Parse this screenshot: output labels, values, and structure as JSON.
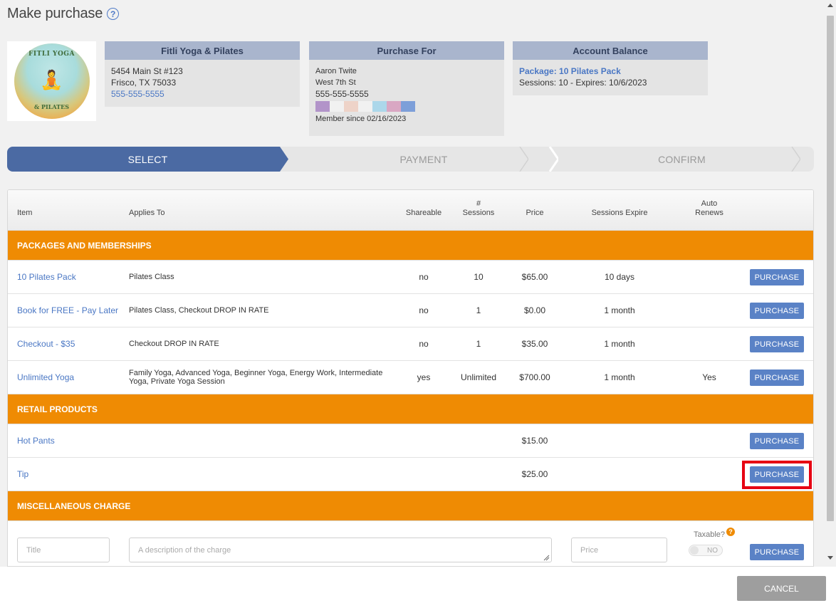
{
  "header": {
    "title": "Make purchase",
    "help_icon": "help-circle-icon"
  },
  "studio": {
    "logo_text_top": "FITLI YOGA",
    "logo_text_bottom": "& PILATES",
    "name": "Fitli Yoga & Pilates",
    "address1": "5454 Main St #123",
    "address2": "Frisco, TX 75033",
    "phone": "555-555-5555"
  },
  "purchase_for": {
    "heading": "Purchase For",
    "name": "Aaron Twite",
    "street": "West 7th St",
    "phone": "555-555-5555",
    "swatch_colors": [
      "#b294c9",
      "#f1f1f1",
      "#eed3c8",
      "#f1f1f1",
      "#acd7ea",
      "#d9a7c3",
      "#7d9fd9"
    ],
    "member_since": "Member since 02/16/2023"
  },
  "account_balance": {
    "heading": "Account Balance",
    "package": "Package: 10 Pilates Pack",
    "sessions": "Sessions: 10 -  Expires: 10/6/2023"
  },
  "steps": [
    "SELECT",
    "PAYMENT",
    "CONFIRM"
  ],
  "columns": {
    "item": "Item",
    "applies_to": "Applies To",
    "shareable": "Shareable",
    "sessions_line1": "#",
    "sessions_line2": "Sessions",
    "price": "Price",
    "expire": "Sessions Expire",
    "auto_line1": "Auto",
    "auto_line2": "Renews"
  },
  "sections": {
    "packages": "PACKAGES AND MEMBERSHIPS",
    "retail": "RETAIL PRODUCTS",
    "misc": "MISCELLANEOUS CHARGE"
  },
  "packages": [
    {
      "item": "10 Pilates Pack",
      "applies": "Pilates Class",
      "shareable": "no",
      "sessions": "10",
      "price": "$65.00",
      "expire": "10 days",
      "auto": "",
      "button": "PURCHASE"
    },
    {
      "item": "Book for FREE - Pay Later",
      "applies": "Pilates Class, Checkout DROP IN RATE",
      "shareable": "no",
      "sessions": "1",
      "price": "$0.00",
      "expire": "1 month",
      "auto": "",
      "button": "PURCHASE"
    },
    {
      "item": "Checkout - $35",
      "applies": "Checkout DROP IN RATE",
      "shareable": "no",
      "sessions": "1",
      "price": "$35.00",
      "expire": "1 month",
      "auto": "",
      "button": "PURCHASE"
    },
    {
      "item": "Unlimited Yoga",
      "applies": "Family Yoga, Advanced Yoga, Beginner Yoga, Energy Work, Intermediate Yoga, Private Yoga Session",
      "shareable": "yes",
      "sessions": "Unlimited",
      "price": "$700.00",
      "expire": "1 month",
      "auto": "Yes",
      "button": "PURCHASE"
    }
  ],
  "retail": [
    {
      "item": "Hot Pants",
      "price": "$15.00",
      "button": "PURCHASE"
    },
    {
      "item": "Tip",
      "price": "$25.00",
      "button": "PURCHASE"
    }
  ],
  "misc": {
    "title_placeholder": "Title",
    "desc_placeholder": "A description of the charge",
    "price_placeholder": "Price",
    "taxable_label": "Taxable?",
    "taxable_help": "?",
    "toggle_value": "NO",
    "button": "PURCHASE"
  },
  "footer": {
    "cancel": "CANCEL"
  }
}
